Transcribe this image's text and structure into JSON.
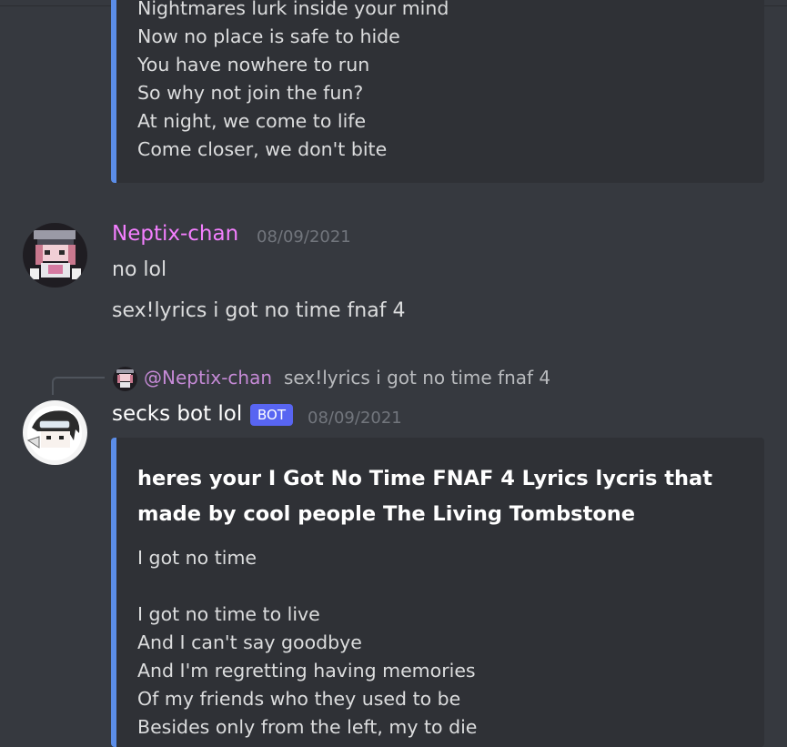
{
  "top_embed": {
    "lines": [
      "Nightmares lurk inside your mind",
      "Now no place is safe to hide",
      "You have nowhere to run",
      "So why not join the fun?",
      "At night, we come to life",
      "Come closer, we don't bite"
    ]
  },
  "message1": {
    "username": "Neptix-chan",
    "username_color": "#f47fff",
    "timestamp": "08/09/2021",
    "lines": [
      "no lol",
      "sex!lyrics i got no time fnaf 4"
    ]
  },
  "message2": {
    "reply": {
      "mention": "@Neptix-chan",
      "text": "sex!lyrics i got no time fnaf 4"
    },
    "username": "secks bot lol",
    "badge": "BOT",
    "timestamp": "08/09/2021",
    "embed": {
      "title": "heres your I Got No Time FNAF 4 Lyrics lycris that made by cool people The Living Tombstone",
      "lines": [
        "I got no time",
        "",
        "I got no time to live",
        "And I can't say goodbye",
        "And I'm regretting having memories",
        "Of my friends who they used to be",
        "Besides only from the left, my to die"
      ]
    }
  },
  "colors": {
    "background": "#36393f",
    "embed_bg": "#2f3136",
    "embed_border": "#5b8de8",
    "badge": "#5865f2"
  }
}
